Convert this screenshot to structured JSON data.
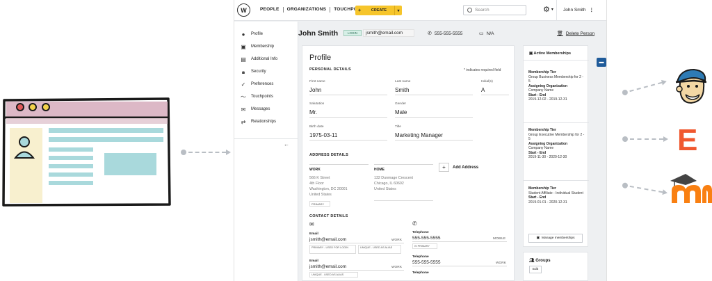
{
  "app": {
    "logo_text": "W",
    "nav": [
      "PEOPLE",
      "ORGANIZATIONS",
      "TOUCHPOINTS"
    ],
    "create_label": "CREATE",
    "search_placeholder": "Search",
    "user_name": "John Smith"
  },
  "sidebar": {
    "items": [
      {
        "label": "Profile",
        "icon": "person-icon"
      },
      {
        "label": "Membership",
        "icon": "membership-card-icon"
      },
      {
        "label": "Additional Info",
        "icon": "info-icon"
      },
      {
        "label": "Security",
        "icon": "lock-icon"
      },
      {
        "label": "Preferences",
        "icon": "check-icon"
      },
      {
        "label": "Touchpoints",
        "icon": "activity-icon"
      },
      {
        "label": "Messages",
        "icon": "envelope-icon"
      },
      {
        "label": "Relationships",
        "icon": "relationships-icon"
      }
    ]
  },
  "header": {
    "name": "John Smith",
    "login_badge": "LOGIN",
    "email": "jsmith@email.com",
    "phone": "555-555-5555",
    "fax": "N/A",
    "delete_label": "Delete Person"
  },
  "profile": {
    "title": "Profile",
    "personal_heading": "PERSONAL DETAILS",
    "required_note": "* indicates required field",
    "fields": {
      "first_name": {
        "label": "First name",
        "value": "John"
      },
      "last_name": {
        "label": "Last name",
        "value": "Smith"
      },
      "initials": {
        "label": "Initial(s)",
        "value": "A"
      },
      "salutation": {
        "label": "Salutation",
        "value": "Mr."
      },
      "gender": {
        "label": "Gender",
        "value": "Male"
      },
      "birth_date": {
        "label": "Birth date",
        "value": "1975-03-11"
      },
      "title": {
        "label": "Title",
        "value": "Marketing Manager"
      }
    },
    "address_heading": "ADDRESS DETAILS",
    "work_address": {
      "label": "WORK",
      "line1": "566 K Street",
      "line2": "4th Floor",
      "line3": "Washington, DC 20001",
      "line4": "United States",
      "tag": "PRIMARY"
    },
    "home_address": {
      "label": "HOME",
      "line1": "132 Dunmage Crescent",
      "line2": "Chicago, IL 60602",
      "line3": "United States"
    },
    "add_address_label": "Add Address",
    "contact_heading": "CONTACT DETAILS",
    "emails": [
      {
        "label": "Email",
        "value": "jsmith@email.com",
        "type": "WORK",
        "tag1": "PRIMARY - USED FOR LOGIN",
        "tag2": "UNIQUE - USED AS ALIAS"
      },
      {
        "label": "Email",
        "value": "jsmith@email.com",
        "type": "WORK",
        "tag1": "UNIQUE - USED AS ALIAS"
      }
    ],
    "phones": [
      {
        "label": "Telephone",
        "value": "555-555-5555",
        "type": "MOBILE",
        "tag1": "IS PRIMARY"
      },
      {
        "label": "Telephone",
        "value": "555-555-5555",
        "type": "WORK"
      },
      {
        "label": "Telephone"
      }
    ]
  },
  "memberships": {
    "heading": "Active Memberships",
    "tier_label": "Membership Tier",
    "org_label": "Assigning Organization",
    "dates_label": "Start - End",
    "items": [
      {
        "tier": "Group Business Membership for 2 - 5",
        "org": "Company Name",
        "dates": "2019-12-02 - 2019-12-31"
      },
      {
        "tier": "Group Executive Membership for 2 - 5",
        "org": "Company Name",
        "dates": "2019-11-30 - 2020-12-30"
      },
      {
        "tier": "Student Affiliate - Individual Student",
        "dates": "2019-01-01 - 2020-12-31"
      }
    ],
    "manage_label": "Manage memberships"
  },
  "groups": {
    "heading": "Groups",
    "edit_label": "Edit"
  },
  "integrations": [
    {
      "icon": "mailchimp-icon"
    },
    {
      "icon": "eventbrite-icon",
      "letter": "E"
    },
    {
      "icon": "moodle-icon"
    }
  ],
  "colors": {
    "accent_yellow": "#f6c52b",
    "eventbrite_orange": "#f0582f",
    "moodle_orange": "#f98012",
    "mailchimp_blue": "#2e7bb4"
  }
}
